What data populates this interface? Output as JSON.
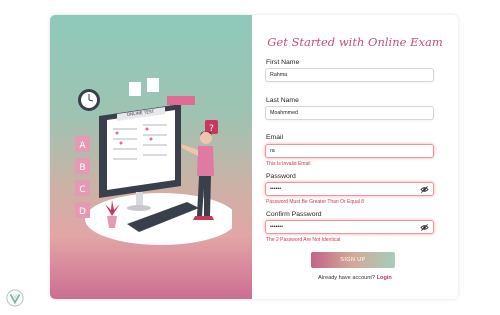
{
  "form": {
    "title": "Get Started with Online Exam",
    "first_name_label": "First Name",
    "first_name_value": "Rahma",
    "last_name_label": "Last Name",
    "last_name_value": "Moahmmed",
    "email_label": "Email",
    "email_value": "ra",
    "email_error": "This Is Invalid Email",
    "password_label": "Password",
    "password_value": "••••••",
    "password_error": "Password Must Be Greater Than Or Equal 8",
    "confirm_label": "Confirm Password",
    "confirm_value": "•••••••",
    "confirm_error": "The 2 Password Are Not Identical",
    "signup_label": "SIGN UP",
    "account_text": "Already have account?",
    "login_label": "Login"
  },
  "illustration": {
    "banner_text": "ONLINE TEST",
    "letters": [
      "A",
      "B",
      "C",
      "D"
    ]
  },
  "colors": {
    "accent": "#c54e80",
    "error": "#d0384f"
  }
}
